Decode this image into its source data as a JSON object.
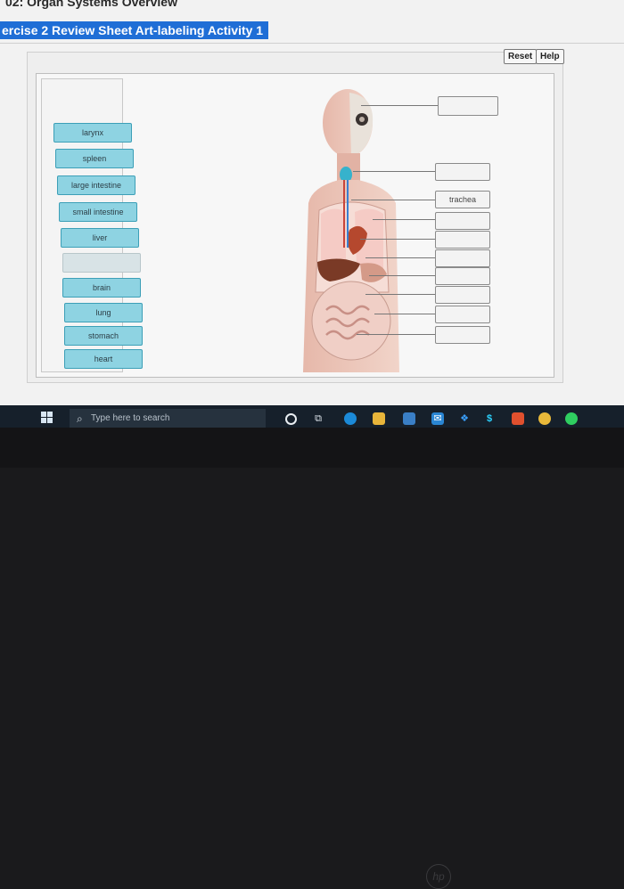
{
  "header": {
    "course_title": "02: Organ Systems Overview",
    "activity_title": "ercise 2 Review Sheet Art-labeling Activity 1"
  },
  "toolbar": {
    "reset_label": "Reset",
    "help_label": "Help"
  },
  "label_bank": {
    "items": [
      "larynx",
      "spleen",
      "large intestine",
      "small intestine",
      "liver",
      "",
      "brain",
      "lung",
      "stomach",
      "heart"
    ]
  },
  "targets": [
    "",
    "",
    "trachea",
    "",
    "",
    "",
    "",
    "",
    "",
    ""
  ],
  "taskbar": {
    "search_placeholder": "Type here to search",
    "icons": [
      "windows-logo-icon",
      "search-icon",
      "cortana-icon",
      "task-view-icon",
      "edge-icon",
      "file-explorer-icon",
      "store-icon",
      "mail-icon",
      "dropbox-icon",
      "dollar-icon",
      "office-icon",
      "chrome-icon",
      "spotify-icon"
    ]
  },
  "colors": {
    "label_fill": "#8ed3e2",
    "label_border": "#3c9fb7",
    "title_highlight": "#1f6ed6",
    "taskbar": "#16202b"
  }
}
